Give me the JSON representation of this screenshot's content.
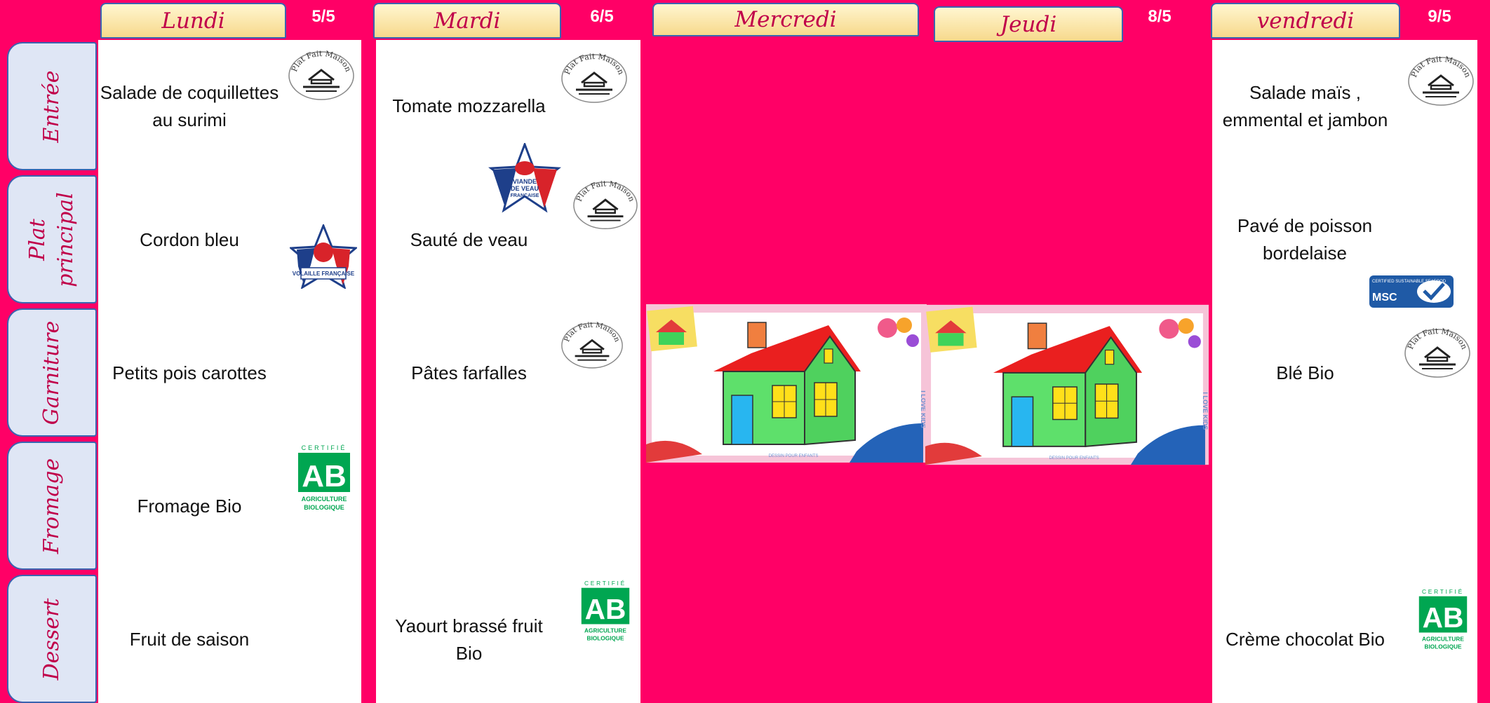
{
  "days": [
    {
      "name": "Lundi",
      "date": "5/5"
    },
    {
      "name": "Mardi",
      "date": "6/5"
    },
    {
      "name": "Mercredi",
      "date": ""
    },
    {
      "name": "Jeudi",
      "date": "8/5"
    },
    {
      "name": "vendredi",
      "date": "9/5"
    }
  ],
  "rows": [
    "Entrée",
    "Plat principal",
    "Garniture",
    "Fromage",
    "Dessert"
  ],
  "monday": {
    "entree": "Salade de coquillettes au surimi",
    "plat": "Cordon bleu",
    "garniture": "Petits pois carottes",
    "fromage": "Fromage Bio",
    "dessert": "Fruit de saison"
  },
  "tuesday": {
    "entree": "Tomate mozzarella",
    "plat": "Sauté de veau",
    "garniture": "Pâtes farfalles",
    "dessert": "Yaourt brassé fruit Bio"
  },
  "friday": {
    "entree": "Salade maïs , emmental et jambon",
    "plat": "Pavé de poisson bordelaise",
    "garniture": "Blé Bio",
    "dessert": "Crème chocolat Bio"
  },
  "logos": {
    "plat_fait_maison": "Plat Fait Maison",
    "ab_top": "CERTIFIÉ",
    "ab_mark": "AB",
    "ab_bottom1": "AGRICULTURE",
    "ab_bottom2": "BIOLOGIQUE",
    "volaille": "VOLAILLE FRANÇAISE",
    "veau1": "VIANDE",
    "veau2": "DE VEAU",
    "veau3": "FRANÇAISE",
    "msc_small": "CERTIFIED SUSTAINABLE SEAFOOD",
    "msc": "MSC"
  },
  "illustration": {
    "side_text": "I LOVE KIDS",
    "footer_text": "DESSIN POUR ENFANTS"
  },
  "colors": {
    "background": "#ff0066",
    "tab_text": "#c0004a",
    "tab_border": "#3a63b0",
    "ab_green": "#00a651"
  }
}
